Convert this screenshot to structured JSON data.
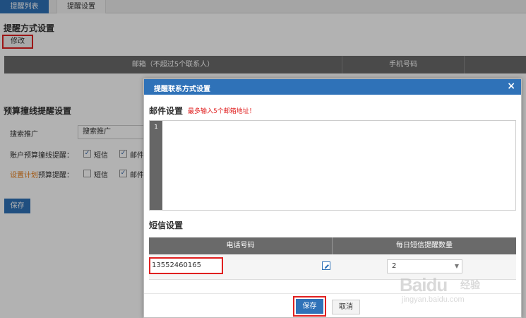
{
  "tabs": [
    "提醒列表",
    "提醒设置"
  ],
  "background": {
    "section1_title": "提醒方式设置",
    "modify_button": "修改",
    "table_headers": [
      "邮箱（不超过5个联系人）",
      "手机号码"
    ],
    "section2_title": "预算撞线提醒设置",
    "rows": {
      "promo_label": "搜索推广",
      "promo_select": "搜索推广",
      "account_label": "账户预算撞线提醒：",
      "plan_label_highlight": "设置计划",
      "plan_label_rest": "预算提醒：",
      "sms": "短信",
      "mail": "邮件"
    },
    "save_button": "保存"
  },
  "modal": {
    "title": "提醒联系方式设置",
    "close": "×",
    "mail_section": "邮件设置",
    "mail_hint": "最多输入5个邮箱地址！",
    "editor_line": "1",
    "sms_section": "短信设置",
    "sms_headers": [
      "电话号码",
      "每日短信提醒数量"
    ],
    "phone": "13552460165",
    "count": "2",
    "save_button": "保存",
    "cancel_button": "取消"
  },
  "watermark": {
    "logo": "Baidu",
    "cn": "经验",
    "url": "jingyan.baidu.com"
  },
  "colors": {
    "accent": "#2f72b8",
    "highlight": "#e02020",
    "orange": "#e87f1c",
    "header_gray": "#6a6a6a"
  }
}
